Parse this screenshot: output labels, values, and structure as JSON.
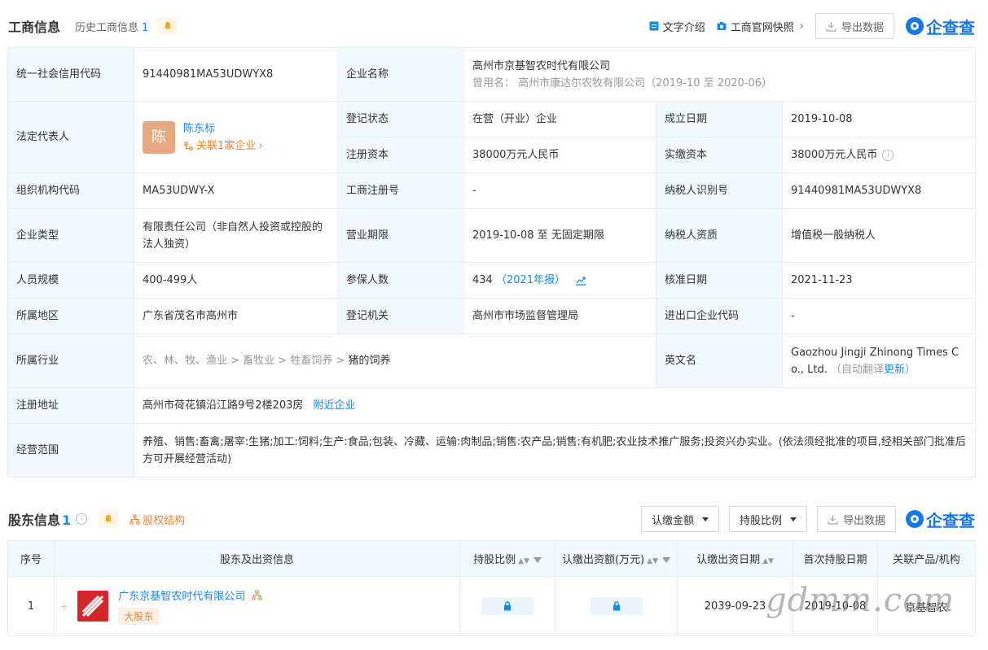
{
  "header": {
    "title": "工商信息",
    "history_label": "历史工商信息",
    "history_count": "1",
    "text_intro": "文字介绍",
    "snapshot": "工商官网快照",
    "export": "导出数据",
    "brand": "企查查"
  },
  "info": {
    "credit_code_label": "统一社会信用代码",
    "credit_code": "91440981MA53UDWYX8",
    "company_name_label": "企业名称",
    "company_name": "高州市京基智农时代有限公司",
    "former_name_prefix": "曾用名：",
    "former_name": "高州市康达尔农牧有限公司（2019-10 至 2020-06）",
    "legal_rep_label": "法定代表人",
    "legal_avatar": "陈",
    "legal_rep": "陈东标",
    "legal_related": "关联1家企业",
    "reg_status_label": "登记状态",
    "reg_status": "在营（开业）企业",
    "est_date_label": "成立日期",
    "est_date": "2019-10-08",
    "reg_capital_label": "注册资本",
    "reg_capital": "38000万元人民币",
    "paid_capital_label": "实缴资本",
    "paid_capital": "38000万元人民币",
    "org_code_label": "组织机构代码",
    "org_code": "MA53UDWY-X",
    "biz_reg_no_label": "工商注册号",
    "biz_reg_no": "-",
    "taxpayer_id_label": "纳税人识别号",
    "taxpayer_id": "91440981MA53UDWYX8",
    "company_type_label": "企业类型",
    "company_type": "有限责任公司（非自然人投资或控股的法人独资）",
    "biz_term_label": "营业期限",
    "biz_term": "2019-10-08 至 无固定期限",
    "taxpayer_qual_label": "纳税人资质",
    "taxpayer_qual": "增值税一般纳税人",
    "staff_size_label": "人员规模",
    "staff_size": "400-499人",
    "insured_label": "参保人数",
    "insured": "434",
    "insured_year": "（2021年报）",
    "approve_date_label": "核准日期",
    "approve_date": "2021-11-23",
    "region_label": "所属地区",
    "region": "广东省茂名市高州市",
    "reg_authority_label": "登记机关",
    "reg_authority": "高州市市场监督管理局",
    "import_export_label": "进出口企业代码",
    "import_export": "-",
    "industry_label": "所属行业",
    "industry_path": "农、林、牧、渔业 > 畜牧业 > 牲畜饲养 >",
    "industry_leaf": "猪的饲养",
    "english_name_label": "英文名",
    "english_name": "Gaozhou Jingji Zhinong Times Co., Ltd.",
    "auto_translate": "（自动翻译",
    "update": "更新",
    "auto_translate_end": "）",
    "reg_address_label": "注册地址",
    "reg_address": "高州市荷花镇沿江路9号2楼203房",
    "nearby": "附近企业",
    "scope_label": "经营范围",
    "scope": "养殖、销售:畜禽;屠宰:生猪;加工:饲料;生产:食品;包装、冷藏、运输:肉制品;销售:农产品;销售:有机肥;农业技术推广服务;投资兴办实业。(依法须经批准的项目,经相关部门批准后方可开展经营活动)"
  },
  "shareholders": {
    "title": "股东信息",
    "count": "1",
    "equity_structure": "股权结构",
    "btn_amount": "认缴金额",
    "btn_ratio": "持股比例",
    "export": "导出数据",
    "brand": "企查查",
    "columns": [
      "序号",
      "股东及出资信息",
      "持股比例",
      "认缴出资额(万元)",
      "认缴出资日期",
      "首次持股日期",
      "关联产品/机构"
    ],
    "rows": [
      {
        "index": "1",
        "name": "广东京基智农时代有限公司",
        "badge": "大股东",
        "contrib_date": "2039-09-23",
        "first_date": "2019-10-08",
        "related": "京基智农"
      }
    ]
  },
  "watermark": "gdmm.com"
}
